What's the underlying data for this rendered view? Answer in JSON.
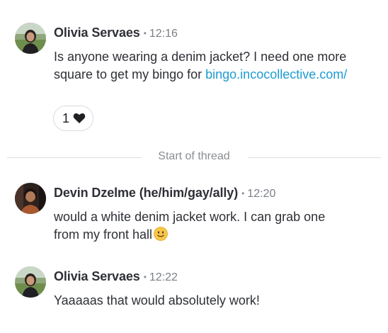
{
  "messages": [
    {
      "author": "Olivia Servaes",
      "separator": "•",
      "time": "12:16",
      "text": "Is anyone wearing a denim jacket? I need one more square to get my bingo for",
      "link": "bingo.incocollective.com/",
      "reaction": {
        "count": "1",
        "icon": "heart-icon"
      }
    },
    {
      "author": "Devin Dzelme (he/him/gay/ally)",
      "separator": "•",
      "time": "12:20",
      "text_line1": "would a white denim jacket work. I can grab one",
      "text_line2": "from my front hall",
      "emoji": "slightly-smiling-face-emoji"
    },
    {
      "author": "Olivia Servaes",
      "separator": "•",
      "time": "12:22",
      "text": "Yaaaaas that would absolutely work!"
    }
  ],
  "thread_divider": {
    "label": "Start of thread"
  },
  "colors": {
    "link": "#1d9bd1",
    "text": "#2e3036",
    "muted": "#8a8d93"
  }
}
